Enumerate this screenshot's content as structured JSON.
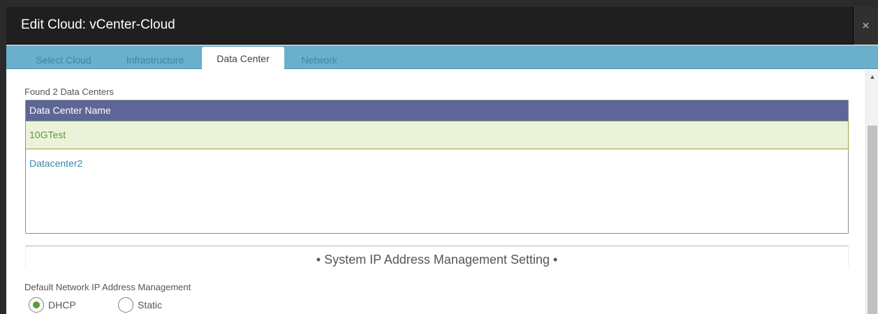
{
  "dialog": {
    "title": "Edit Cloud: vCenter-Cloud",
    "close_icon": "×"
  },
  "tabs": [
    {
      "label": "Select Cloud",
      "active": false
    },
    {
      "label": "Infrastructure",
      "active": false
    },
    {
      "label": "Data Center",
      "active": true
    },
    {
      "label": "Network",
      "active": false
    }
  ],
  "data_centers": {
    "found_text": "Found 2 Data Centers",
    "column_header": "Data Center Name",
    "rows": [
      {
        "name": "10GTest",
        "selected": true
      },
      {
        "name": "Datacenter2",
        "selected": false
      }
    ]
  },
  "ip_management": {
    "section_title": "• System IP Address Management Setting •",
    "default_label": "Default Network IP Address Management",
    "options": [
      {
        "label": "DHCP",
        "checked": true
      },
      {
        "label": "Static",
        "checked": false
      }
    ]
  },
  "scrollbar": {
    "up_icon": "▲"
  },
  "colors": {
    "title_bar": "#1f1f1f",
    "tab_bar": "#6aafcc",
    "table_header": "#5d6696",
    "selected_row": "#ecf2d9",
    "radio_accent": "#5a9a3a"
  }
}
